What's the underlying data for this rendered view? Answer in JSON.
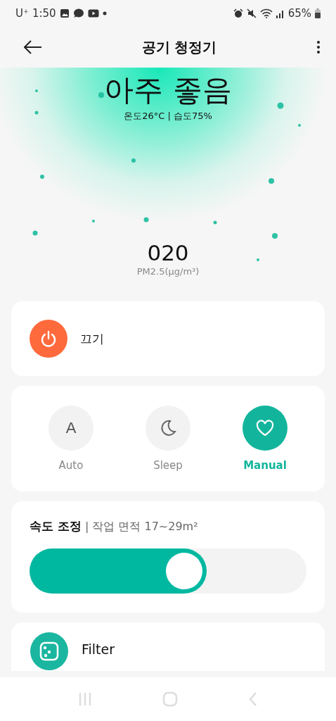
{
  "status_bar": {
    "carrier": "U⁺",
    "time": "1:50",
    "battery": "65%"
  },
  "header": {
    "title": "공기 청정기"
  },
  "air_quality": {
    "grade": "아주 좋음",
    "conditions": "온도26°C | 습도75%",
    "pm_value": "020",
    "pm_unit": "PM2.5(μg/m³)"
  },
  "power": {
    "label": "끄기",
    "on": true
  },
  "modes": [
    {
      "kind": "auto",
      "label": "Auto",
      "glyph": "A",
      "selected": false
    },
    {
      "kind": "sleep",
      "label": "Sleep",
      "selected": false
    },
    {
      "kind": "manual",
      "label": "Manual",
      "selected": true
    }
  ],
  "speed": {
    "title": "속도 조정",
    "separator": "|",
    "subtitle": "작업 면적 17~29m²",
    "level": 0.64
  },
  "filter": {
    "title": "Filter"
  }
}
